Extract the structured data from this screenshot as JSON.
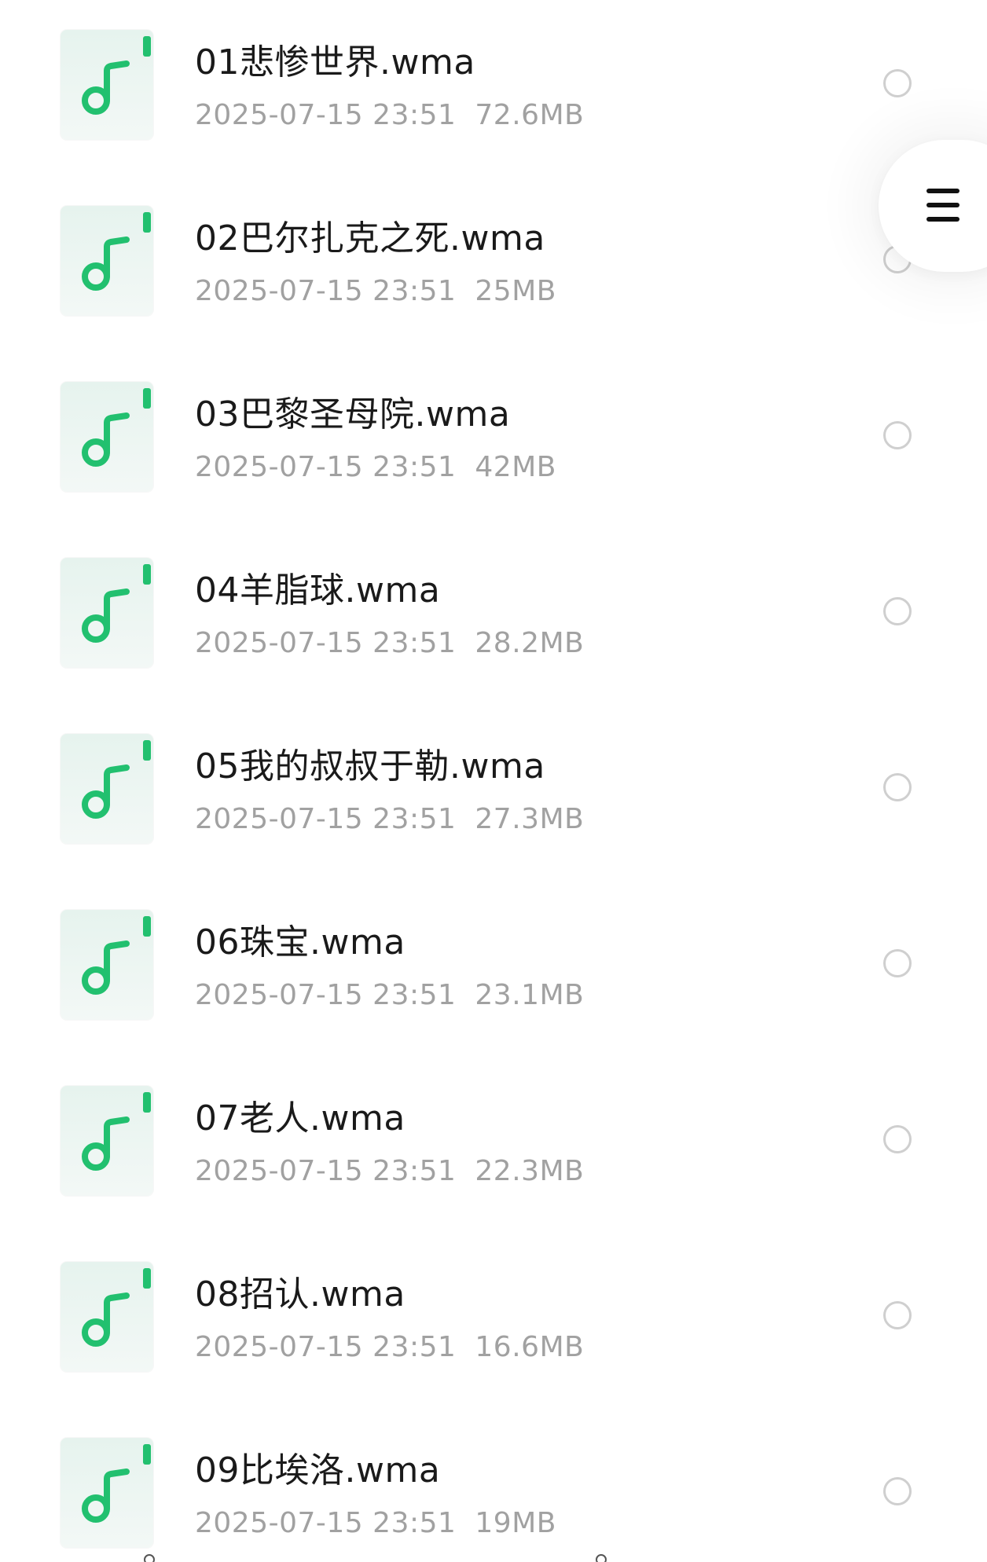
{
  "files": [
    {
      "name": "01悲惨世界.wma",
      "date": "2025-07-15 23:51",
      "size": "72.6MB",
      "selected": false,
      "icon": "music-file-icon"
    },
    {
      "name": "02巴尔扎克之死.wma",
      "date": "2025-07-15 23:51",
      "size": "25MB",
      "selected": false,
      "icon": "music-file-icon"
    },
    {
      "name": "03巴黎圣母院.wma",
      "date": "2025-07-15 23:51",
      "size": "42MB",
      "selected": false,
      "icon": "music-file-icon"
    },
    {
      "name": "04羊脂球.wma",
      "date": "2025-07-15 23:51",
      "size": "28.2MB",
      "selected": false,
      "icon": "music-file-icon"
    },
    {
      "name": "05我的叔叔于勒.wma",
      "date": "2025-07-15 23:51",
      "size": "27.3MB",
      "selected": false,
      "icon": "music-file-icon"
    },
    {
      "name": "06珠宝.wma",
      "date": "2025-07-15 23:51",
      "size": "23.1MB",
      "selected": false,
      "icon": "music-file-icon"
    },
    {
      "name": "07老人.wma",
      "date": "2025-07-15 23:51",
      "size": "22.3MB",
      "selected": false,
      "icon": "music-file-icon"
    },
    {
      "name": "08招认.wma",
      "date": "2025-07-15 23:51",
      "size": "16.6MB",
      "selected": false,
      "icon": "music-file-icon"
    },
    {
      "name": "09比埃洛.wma",
      "date": "2025-07-15 23:51",
      "size": "19MB",
      "selected": false,
      "icon": "music-file-icon"
    }
  ],
  "floating_menu": {
    "icon": "menu-icon"
  },
  "colors": {
    "accent_green": "#22c06f",
    "title_text": "#1a1a1a",
    "meta_text": "#a1a1a1",
    "radio_border": "#cfcfcf"
  }
}
